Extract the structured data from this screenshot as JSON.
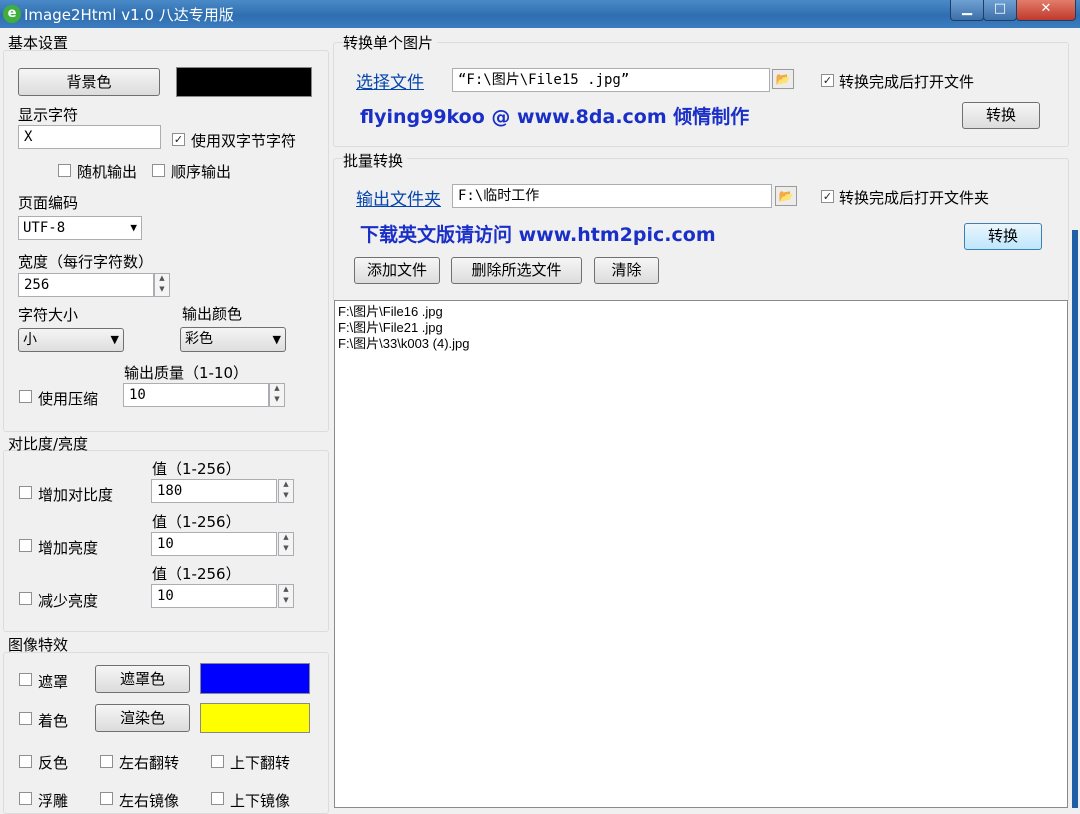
{
  "window": {
    "title": "Image2Html v1.0 八达专用版",
    "app_icon": "e",
    "minimize_glyph": "▁",
    "maximize_glyph": "□",
    "close_glyph": "✕"
  },
  "basic": {
    "title": "基本设置",
    "bg_button": "背景色",
    "bg_color": "#000000",
    "display_char_label": "显示字符",
    "display_char_value": "X",
    "double_byte": {
      "label": "使用双字节字符",
      "checked": true
    },
    "random_output": {
      "label": "随机输出",
      "checked": false
    },
    "sequential_output": {
      "label": "顺序输出",
      "checked": false
    },
    "encoding_label": "页面编码",
    "encoding_value": "UTF-8",
    "width_label": "宽度（每行字符数）",
    "width_value": "256",
    "char_size_label": "字符大小",
    "char_size_value": "小",
    "output_color_label": "输出颜色",
    "output_color_value": "彩色",
    "quality_label": "输出质量（1-10）",
    "quality_value": "10",
    "compress": {
      "label": "使用压缩",
      "checked": false
    }
  },
  "contrast": {
    "title": "对比度/亮度",
    "value_label": "值（1-256）",
    "rows": [
      {
        "label": "增加对比度",
        "value": "180",
        "checked": false
      },
      {
        "label": "增加亮度",
        "value": "10",
        "checked": false
      },
      {
        "label": "减少亮度",
        "value": "10",
        "checked": false
      }
    ]
  },
  "effects": {
    "title": "图像特效",
    "mask": {
      "label": "遮罩",
      "checked": false,
      "button": "遮罩色",
      "color": "#0000ff"
    },
    "tint": {
      "label": "着色",
      "checked": false,
      "button": "渲染色",
      "color": "#ffff00"
    },
    "row1": [
      {
        "label": "反色"
      },
      {
        "label": "左右翻转"
      },
      {
        "label": "上下翻转"
      }
    ],
    "row2": [
      {
        "label": "浮雕"
      },
      {
        "label": "左右镜像"
      },
      {
        "label": "上下镜像"
      }
    ]
  },
  "single": {
    "title": "转换单个图片",
    "select_link": "选择文件",
    "path": "“F:\\图片\\File15 .jpg”",
    "open_after": {
      "label": "转换完成后打开文件",
      "checked": true
    },
    "credit": "flying99koo @ www.8da.com 倾情制作",
    "convert": "转换"
  },
  "batch": {
    "title": "批量转换",
    "output_link": "输出文件夹",
    "path": "F:\\临时工作",
    "open_after": {
      "label": "转换完成后打开文件夹",
      "checked": true
    },
    "promo": "下载英文版请访问 www.htm2pic.com",
    "convert": "转换",
    "add": "添加文件",
    "delete": "删除所选文件",
    "clear": "清除"
  },
  "files": [
    "F:\\图片\\File16 .jpg",
    "F:\\图片\\File21 .jpg",
    "F:\\图片\\33\\k003 (4).jpg"
  ],
  "icons": {
    "folder": "folder-open-icon",
    "check": "✓",
    "spin_up": "▲",
    "spin_down": "▼",
    "dropdown": "▼"
  }
}
